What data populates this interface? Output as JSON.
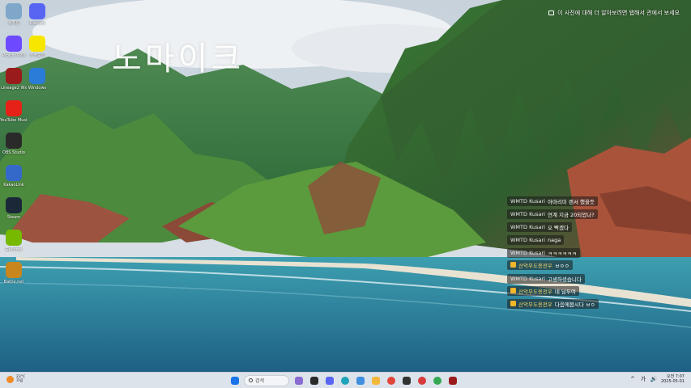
{
  "desktop": {
    "watermark": "노마이크",
    "spotlight_label": "이 사진에 대해 더 알아보려면 탭해서 관에서 보세요",
    "icons": [
      {
        "label": "휴지통",
        "icon": "recycle-bin-icon",
        "color": "#7fa7c9"
      },
      {
        "label": "Discord",
        "icon": "discord-icon",
        "color": "#5865f2"
      },
      {
        "label": "Proton VPN",
        "icon": "proton-vpn-icon",
        "color": "#6d4aff"
      },
      {
        "label": "카카오톡",
        "icon": "kakaotalk-icon",
        "color": "#f7e600"
      },
      {
        "label": "Lineage2 Ws",
        "icon": "game-launcher-icon",
        "color": "#9a1b1b"
      },
      {
        "label": "Windows",
        "icon": "windows-icon",
        "color": "#2b7bd8"
      },
      {
        "label": "YouTube Music",
        "icon": "youtube-music-icon",
        "color": "#e62117"
      },
      {
        "label": "OBS Studio",
        "icon": "obs-studio-icon",
        "color": "#2a2a2a"
      },
      {
        "label": "KakaoLink",
        "icon": "network-icon",
        "color": "#3569c9"
      },
      {
        "label": "Steam",
        "icon": "steam-icon",
        "color": "#1b2838"
      },
      {
        "label": "GeForce",
        "icon": "nvidia-icon",
        "color": "#76b900"
      },
      {
        "label": "Battle.net",
        "icon": "shield-game-icon",
        "color": "#c8861c"
      }
    ]
  },
  "chat": {
    "messages": [
      {
        "user": "WMTD Kusari",
        "text": "아마리미 렌서 했을듯",
        "donor": false
      },
      {
        "user": "WMTD Kusari",
        "text": "연계 지금 20되었나?",
        "donor": false
      },
      {
        "user": "WMTD Kusari",
        "text": "오 빡겠다",
        "donor": false
      },
      {
        "user": "WMTD Kusari",
        "text": "naga",
        "donor": false
      },
      {
        "user": "WMTD Kusari",
        "text": "ㅋㅋㅋㅋㅋㅋ",
        "donor": false
      },
      {
        "user": "산악무도용전우",
        "text": "ㅂㅇㅇ",
        "donor": true
      },
      {
        "user": "WMTD Kusari",
        "text": "고생하셨습니다",
        "donor": false
      },
      {
        "user": "산악무도용전우",
        "text": "네 님두여",
        "donor": true
      },
      {
        "user": "산악무도용전우",
        "text": "다음에봅시다 ㅂㅇ",
        "donor": true
      }
    ]
  },
  "taskbar": {
    "weather": {
      "temp": "23°C",
      "status": "흐림"
    },
    "search_placeholder": "검색",
    "apps": [
      {
        "name": "start-button",
        "icon": "windows-logo-icon",
        "color": "#1a73e8"
      },
      {
        "name": "task-view-button",
        "icon": "task-view-icon",
        "color": "#8a6bd1"
      },
      {
        "name": "file-explorer-button",
        "icon": "folder-icon",
        "color": "#2a2a2a"
      },
      {
        "name": "discord-taskbar-button",
        "icon": "discord-icon",
        "color": "#5865f2"
      },
      {
        "name": "edge-taskbar-button",
        "icon": "edge-icon",
        "color": "#1fa3b8"
      },
      {
        "name": "photos-taskbar-button",
        "icon": "photos-icon",
        "color": "#3e8fe0"
      },
      {
        "name": "folder-taskbar-button",
        "icon": "folder-icon",
        "color": "#f2b83c"
      },
      {
        "name": "chrome-taskbar-button",
        "icon": "chrome-icon",
        "color": "#e0453a"
      },
      {
        "name": "obs-taskbar-button",
        "icon": "obs-studio-icon",
        "color": "#333333"
      },
      {
        "name": "record-taskbar-button",
        "icon": "record-icon",
        "color": "#d83b3b"
      },
      {
        "name": "chrome2-taskbar-button",
        "icon": "chrome-icon",
        "color": "#34a853"
      },
      {
        "name": "game-taskbar-button",
        "icon": "game-launcher-icon",
        "color": "#9a1b1b"
      }
    ],
    "tray": {
      "chevron": "^",
      "lang": "가",
      "volume": "🔊",
      "time": "오전 7:07",
      "date": "2025-05-01"
    }
  }
}
